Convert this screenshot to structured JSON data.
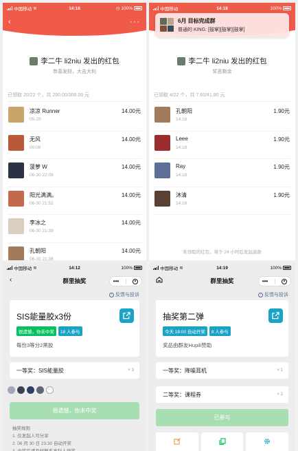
{
  "colors": {
    "red": "#f05a48",
    "green": "#07c160",
    "teal": "#1ba3c6",
    "link": "#576b95"
  },
  "p1": {
    "status": {
      "carrier": "中国移动",
      "time": "14:16",
      "battery": "100%"
    },
    "sender": "李二牛 li2niu 发出的红包",
    "greeting": "恭喜发财，大吉大利",
    "summary": "已领取 20/22 个，共 280.00/308.00 元",
    "rows": [
      {
        "name": "凉凉 Runner",
        "time": "05-20",
        "amount": "14.00元",
        "color": "#c9a46b"
      },
      {
        "name": "无风",
        "time": "00:08",
        "amount": "14.00元",
        "color": "#b85a3a"
      },
      {
        "name": "菠萝 W",
        "time": "06-30 22:08",
        "amount": "14.00元",
        "color": "#2c3246"
      },
      {
        "name": "阳光满满。",
        "time": "06-30 21:52",
        "amount": "14.00元",
        "color": "#c36a4d"
      },
      {
        "name": "李冰之",
        "time": "06-30 21:39",
        "amount": "14.00元",
        "color": "#d8cfc1"
      },
      {
        "name": "孔朝阳",
        "time": "06-30 21:38",
        "amount": "14.00元",
        "color": "#a27b5c"
      }
    ]
  },
  "p2": {
    "status": {
      "carrier": "中国移动",
      "time": "14:18",
      "battery": "100%"
    },
    "notify": {
      "title": "6月 目标完成群",
      "text": "普通的 KING: [鼓掌][鼓掌][鼓掌]"
    },
    "sender": "李二牛 li2niu 发出的红包",
    "greeting": "奖恶剩余",
    "summary": "已领取 4/22 个，共 7.60/41.80 元",
    "rows": [
      {
        "name": "孔朝阳",
        "time": "14:18",
        "amount": "1.90元",
        "color": "#a27b5c"
      },
      {
        "name": "Leee",
        "time": "14:18",
        "amount": "1.90元",
        "color": "#9c2d2f"
      },
      {
        "name": "Ray",
        "time": "14:18",
        "amount": "1.90元",
        "color": "#5d6f96"
      },
      {
        "name": "沐清",
        "time": "14:18",
        "amount": "1.90元",
        "color": "#5a4032"
      }
    ],
    "footnote": "未领取的红包，将于 24 小时后发起退款"
  },
  "p3": {
    "status": {
      "carrier": "中国移动",
      "time": "14:12",
      "battery": "100%"
    },
    "nav_title": "群里抽奖",
    "feedback": "反馈与投诉",
    "card_title": "SIS能量胶x3份",
    "tag1": "很遗憾，你未中奖",
    "tag2": "18 人参与",
    "sub": "每份3等分2黑胶",
    "prize_label": "一等奖：SIS能量胶",
    "prize_qty": "× 3",
    "avatar_colors": [
      "#a3a8b6",
      "#3b4251",
      "#2d3d63",
      "#5d6874"
    ],
    "more_glyph": "···",
    "button": "很遗憾，你未中奖",
    "rules": [
      "抽奖规则",
      "1. 仅发起人可分享",
      "2. 06 月 30 日 23:30 自动开奖",
      "3. 中奖后请及时联系发起人领奖"
    ]
  },
  "p4": {
    "status": {
      "carrier": "中国移动",
      "time": "14:19",
      "battery": "100%"
    },
    "nav_title": "群里抽奖",
    "feedback": "反馈与投诉",
    "card_title": "抽奖第二弹",
    "tag1": "今天 18:00 自动开奖",
    "tag2": "8 人参与",
    "sub": "奖品由群友Hupili赞助",
    "prize1_label": "一等奖：降噪耳机",
    "prize1_qty": "× 1",
    "prize2_label": "二等奖：课程券",
    "prize2_qty": "× 2",
    "button": "已参与",
    "toolbar": [
      "edit-icon",
      "copy-icon",
      "settings-icon"
    ]
  }
}
